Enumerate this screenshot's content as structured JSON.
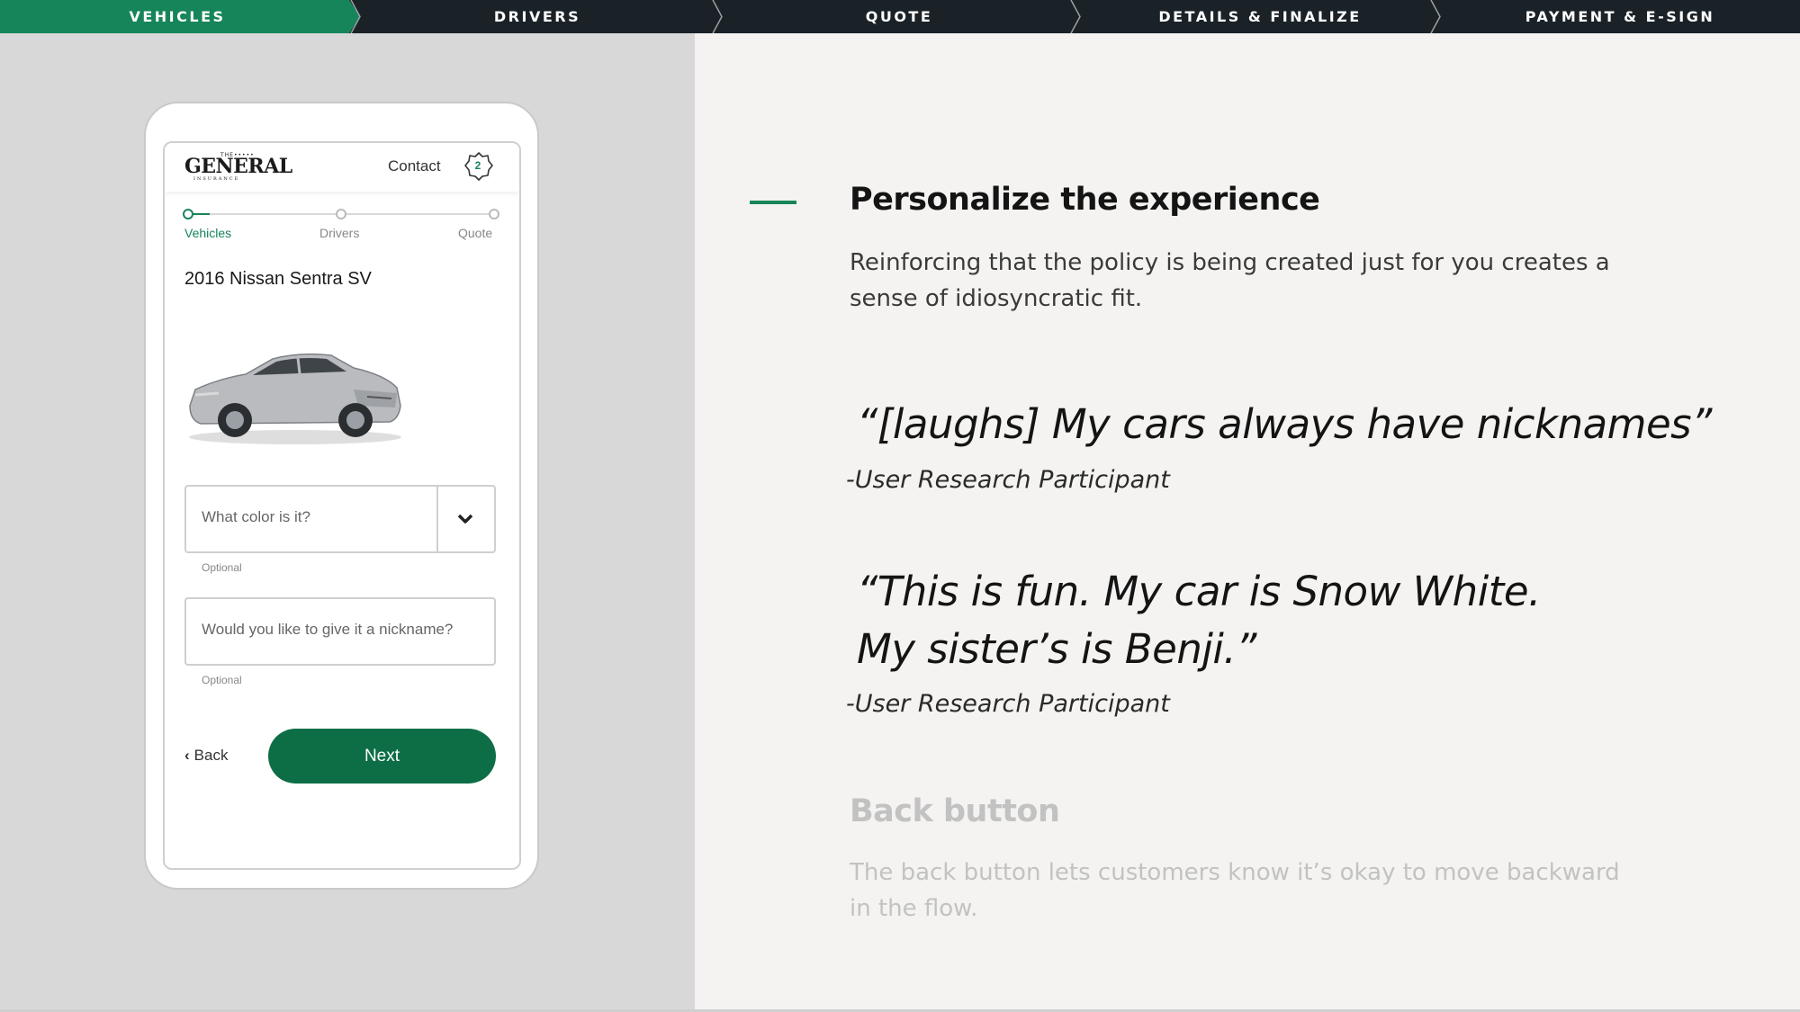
{
  "topnav": {
    "steps": [
      "VEHICLES",
      "DRIVERS",
      "QUOTE",
      "DETAILS & FINALIZE",
      "PAYMENT & E-SIGN"
    ],
    "active_index": 0
  },
  "phone": {
    "logo": {
      "main": "GENERAL",
      "dots": "THE•••••",
      "sub": "INSURANCE"
    },
    "contact_label": "Contact",
    "cart_count": "2",
    "progress_steps": [
      "Vehicles",
      "Drivers",
      "Quote"
    ],
    "vehicle_name": "2016 Nissan Sentra SV",
    "color_field": {
      "placeholder": "What color is it?",
      "hint": "Optional"
    },
    "nickname_field": {
      "placeholder": "Would you like to give it a nickname?",
      "hint": "Optional"
    },
    "back_label": "Back",
    "next_label": "Next"
  },
  "content": {
    "title": "Personalize the experience",
    "description": "Reinforcing that the policy is being created just for you creates a sense of idiosyncratic fit.",
    "quote1": "“[laughs] My cars always have nicknames”",
    "quote1_attribution": "-User Research Participant",
    "quote2_line1": "“This is fun. My car is Snow White.",
    "quote2_line2": "My sister’s is Benji.”",
    "quote2_attribution": "-User Research Participant",
    "next_title": "Back button",
    "next_description": "The back button lets customers know it’s okay to move backward in the flow."
  },
  "colors": {
    "brand_green": "#16855a",
    "button_green": "#0d6e46",
    "nav_dark": "#1b2227",
    "left_panel": "#d8d8d8",
    "page_bg": "#f4f3f1"
  }
}
